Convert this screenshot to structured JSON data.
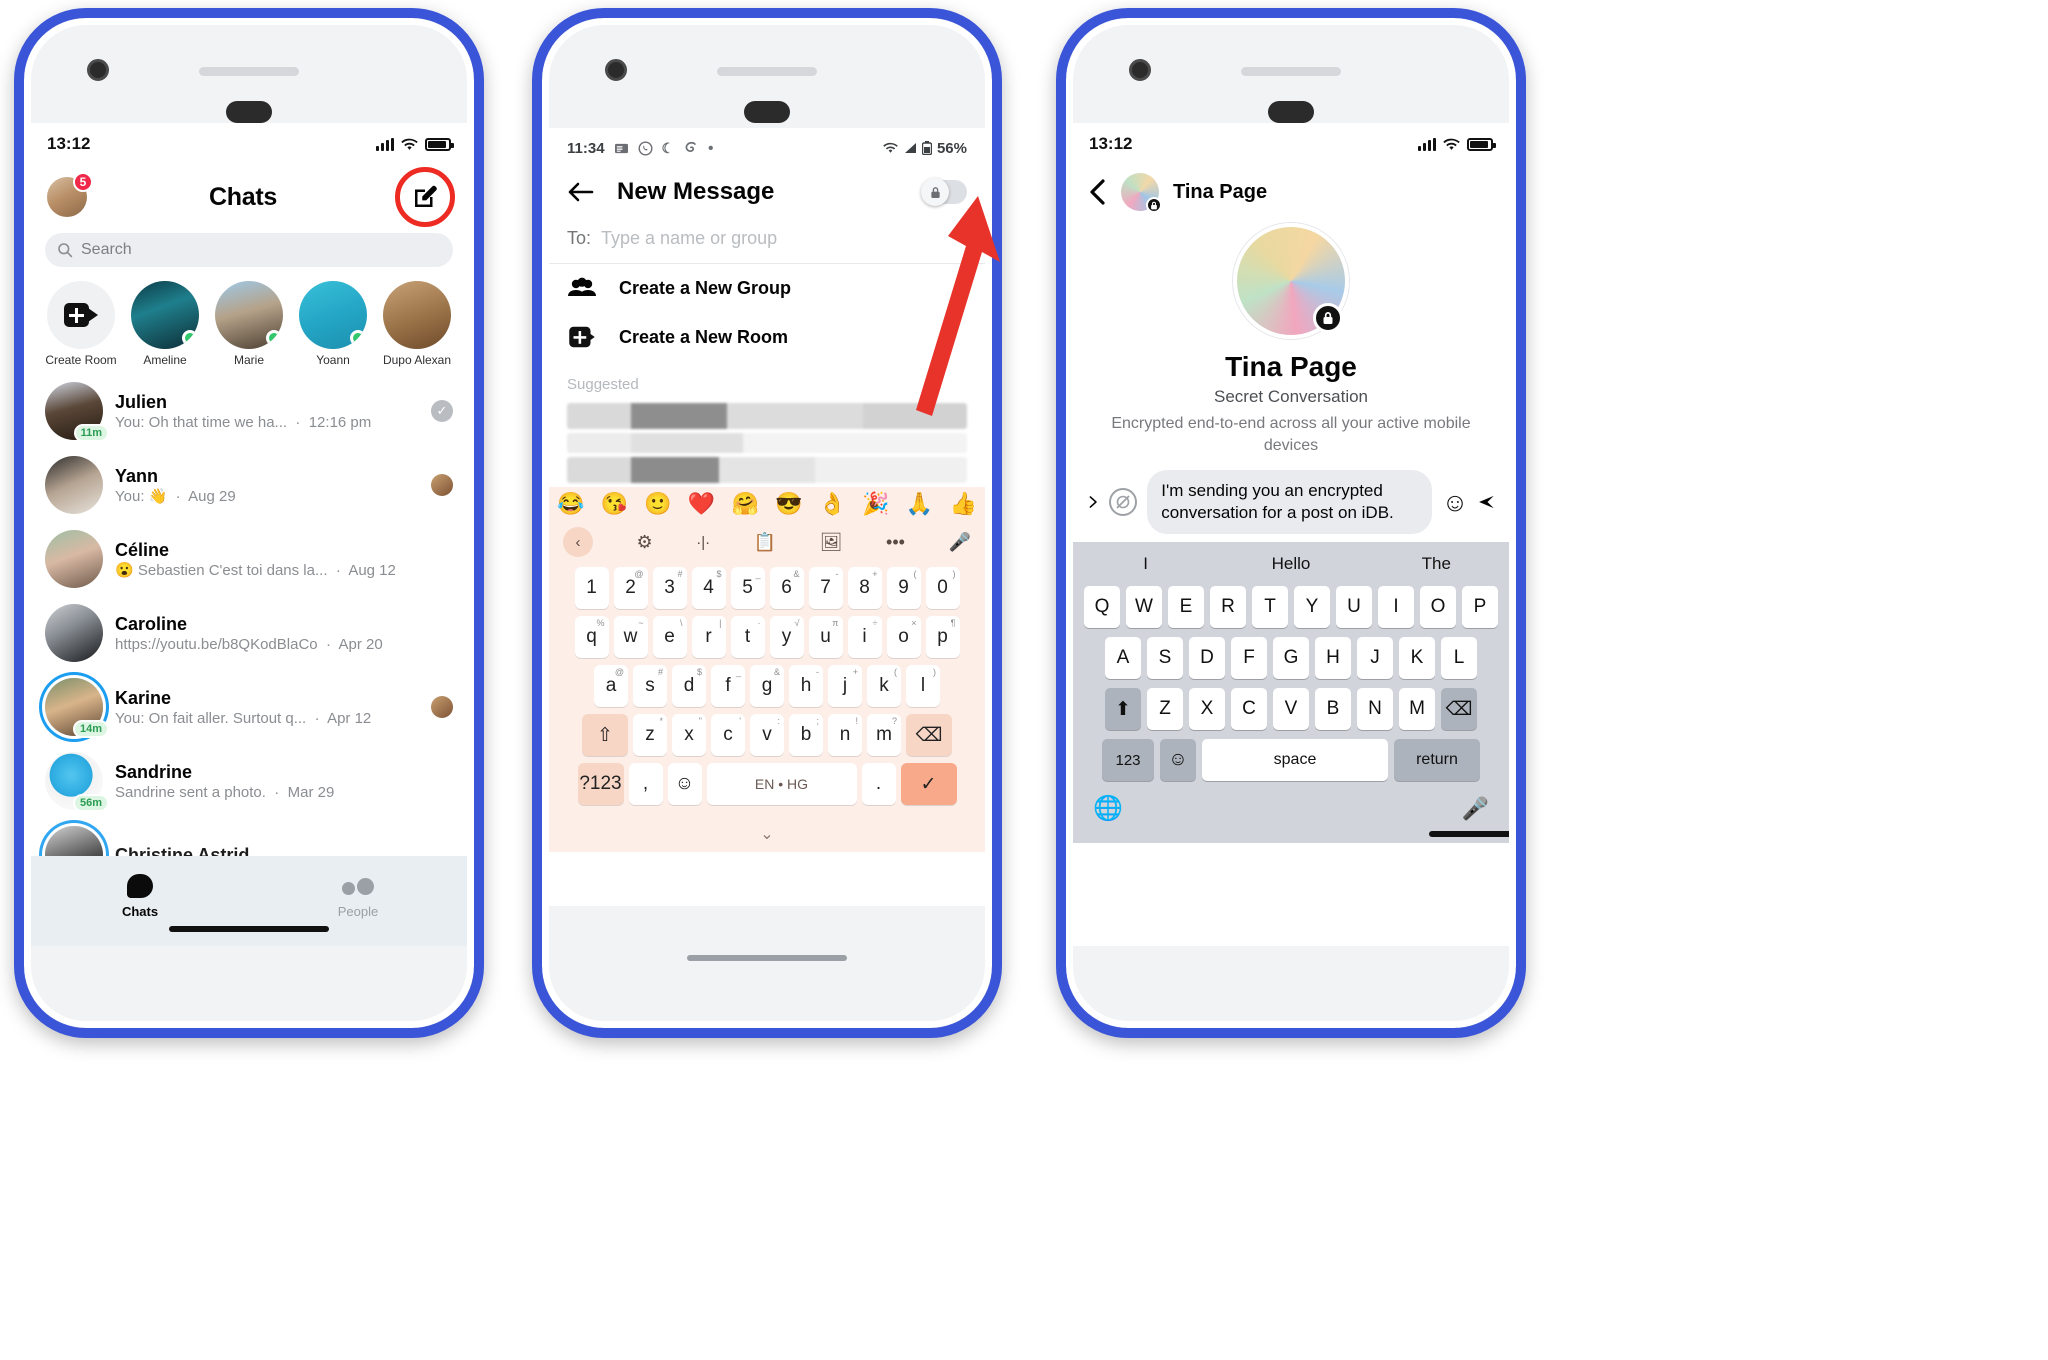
{
  "phone1": {
    "status": {
      "time": "13:12",
      "signal_icon": "cellular-bars-icon",
      "wifi_icon": "wifi-icon",
      "battery_icon": "battery-icon"
    },
    "header": {
      "avatar_badge": "5",
      "title": "Chats",
      "compose_icon": "compose-icon"
    },
    "search": {
      "placeholder": "Search",
      "icon": "search-icon"
    },
    "stories": [
      {
        "label": "Create Room",
        "type": "create-room",
        "icon": "video-plus-icon",
        "online": false
      },
      {
        "label": "Ameline",
        "online": true
      },
      {
        "label": "Marie",
        "online": true
      },
      {
        "label": "Yoann",
        "online": true
      },
      {
        "label": "Dupo Alexan",
        "online": false
      }
    ],
    "chats": [
      {
        "name": "Julien",
        "preview": "You: Oh that time we ha...",
        "time": "12:16 pm",
        "chip": "11m",
        "trailing": "seen-tick"
      },
      {
        "name": "Yann",
        "preview": "You: 👋",
        "time": "Aug 29",
        "chip": "",
        "trailing": "mini-avatar"
      },
      {
        "name": "Céline",
        "preview": "😮 Sebastien  C'est toi dans la...",
        "time": "Aug 12",
        "chip": "",
        "trailing": ""
      },
      {
        "name": "Caroline",
        "preview": "https://youtu.be/b8QKodBlaCo",
        "time": "Apr 20",
        "chip": "",
        "trailing": ""
      },
      {
        "name": "Karine",
        "preview": "You: On fait aller. Surtout q...",
        "time": "Apr 12",
        "chip": "14m",
        "trailing": "mini-avatar"
      },
      {
        "name": "Sandrine",
        "preview": "Sandrine sent a photo.",
        "time": "Mar 29",
        "chip": "56m",
        "trailing": ""
      },
      {
        "name": "Christine Astrid",
        "preview": "",
        "time": "",
        "chip": "",
        "trailing": ""
      }
    ],
    "tabs": [
      {
        "label": "Chats",
        "icon": "chat-bubble-icon",
        "active": true
      },
      {
        "label": "People",
        "icon": "people-icon",
        "active": false
      }
    ]
  },
  "phone2": {
    "status": {
      "time": "11:34",
      "battery_percent": "56%",
      "icons": [
        "news-icon",
        "whatsapp-icon",
        "moon-icon",
        "swirl-icon",
        "dot-icon"
      ],
      "wifi_icon": "wifi-icon",
      "signal_icon": "signal-icon",
      "battery_icon": "battery-icon"
    },
    "header": {
      "back_icon": "back-arrow-icon",
      "title": "New Message",
      "toggle": {
        "state": "off",
        "icon": "lock-icon"
      }
    },
    "to_row": {
      "label": "To:",
      "placeholder": "Type a name or group"
    },
    "actions": [
      {
        "label": "Create a New Group",
        "icon": "group-icon"
      },
      {
        "label": "Create a New Room",
        "icon": "video-plus-icon"
      }
    ],
    "suggested_label": "Suggested",
    "keyboard": {
      "emojis": [
        "😂",
        "😘",
        "🙂",
        "❤️",
        "🤗",
        "😎",
        "👌",
        "🎉",
        "🙏",
        "👍"
      ],
      "toolbar_icons": [
        "chevron-left-icon",
        "gear-icon",
        "text-cursor-icon",
        "clipboard-icon",
        "sticker-icon",
        "more-icon",
        "microphone-icon"
      ],
      "row_numbers": [
        "1",
        "2",
        "3",
        "4",
        "5",
        "6",
        "7",
        "8",
        "9",
        "0"
      ],
      "row_numbers_sup": [
        "",
        "@",
        "#",
        "$",
        "_",
        "&",
        "-",
        "+",
        "(",
        ")"
      ],
      "row1": [
        "q",
        "w",
        "e",
        "r",
        "t",
        "y",
        "u",
        "i",
        "o",
        "p"
      ],
      "row1_sup": [
        "%",
        "~",
        "\\",
        "|",
        "·",
        "√",
        "π",
        "÷",
        "×",
        "¶"
      ],
      "row2": [
        "a",
        "s",
        "d",
        "f",
        "g",
        "h",
        "j",
        "k",
        "l"
      ],
      "row2_sup": [
        "@",
        "#",
        "$",
        "_",
        "&",
        "-",
        "+",
        "(",
        ")"
      ],
      "row3_shift": "shift-icon",
      "row3": [
        "z",
        "x",
        "c",
        "v",
        "b",
        "n",
        "m"
      ],
      "row3_sup": [
        "*",
        "\"",
        "'",
        ":",
        ";",
        "!",
        "?"
      ],
      "row3_backspace": "backspace-icon",
      "bottom": {
        "symbols": "?123",
        "comma": ",",
        "emoji": "emoji-icon",
        "space": "EN • HG",
        "period": ".",
        "enter": "check-icon"
      },
      "hide_icon": "chevron-down-icon"
    }
  },
  "phone3": {
    "status": {
      "time": "13:12",
      "signal_icon": "cellular-bars-icon",
      "wifi_icon": "wifi-icon",
      "battery_icon": "battery-icon"
    },
    "header": {
      "back_icon": "back-chevron-icon",
      "name": "Tina Page",
      "lock_icon": "lock-icon"
    },
    "hero": {
      "name": "Tina Page",
      "subtitle": "Secret Conversation",
      "description": "Encrypted end-to-end across all your active mobile devices",
      "lock_icon": "lock-icon"
    },
    "message": {
      "text": "I'm sending you an encrypted conversation for a post on iDB.",
      "left_icon": "send-chevron-icon",
      "timer_icon": "disappearing-timer-icon",
      "emoji_icon": "smiley-icon",
      "send_icon": "send-icon"
    },
    "keyboard": {
      "predictions": [
        "I",
        "Hello",
        "The"
      ],
      "row1": [
        "Q",
        "W",
        "E",
        "R",
        "T",
        "Y",
        "U",
        "I",
        "O",
        "P"
      ],
      "row2": [
        "A",
        "S",
        "D",
        "F",
        "G",
        "H",
        "J",
        "K",
        "L"
      ],
      "row3": [
        "Z",
        "X",
        "C",
        "V",
        "B",
        "N",
        "M"
      ],
      "shift_icon": "shift-up-icon",
      "backspace_icon": "backspace-icon",
      "numbers_key": "123",
      "emoji_key": "emoji-icon",
      "space_key": "space",
      "return_key": "return",
      "globe_icon": "globe-icon",
      "mic_icon": "microphone-icon"
    }
  },
  "annotation": {
    "compose_highlight_color": "#ee2b23",
    "arrow_color": "#e8332a",
    "arrow_name": "red-pointer-arrow"
  }
}
